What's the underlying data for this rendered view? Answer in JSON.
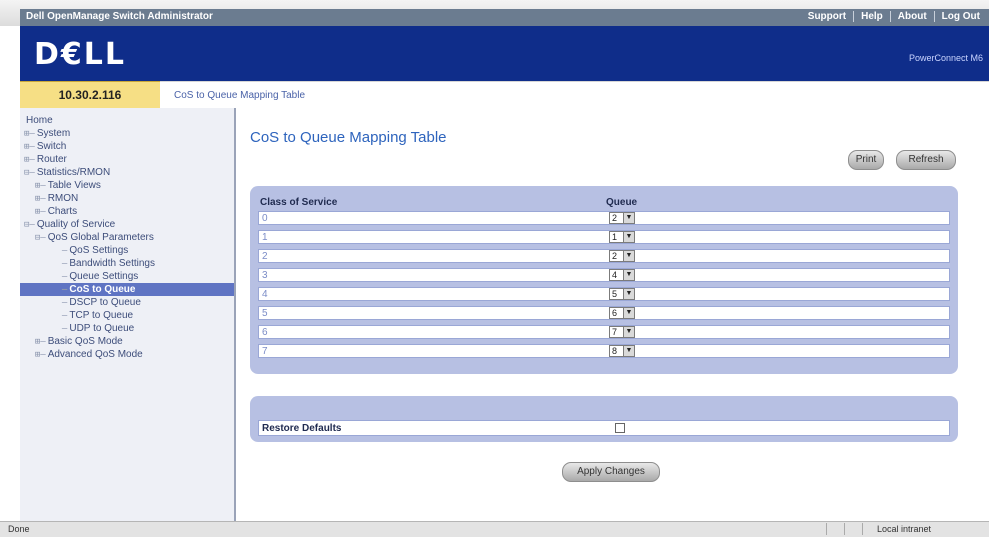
{
  "window": {
    "title": "Dell OpenManage Switch Administrator",
    "links": [
      "Support",
      "Help",
      "About",
      "Log Out"
    ]
  },
  "banner": {
    "logo": "D€LL",
    "subtitle": "PowerConnect M6"
  },
  "device": {
    "ip": "10.30.2.116"
  },
  "breadcrumb": "CoS to Queue Mapping Table",
  "sidebar": {
    "items": [
      {
        "prefix": "",
        "label": "Home"
      },
      {
        "prefix": "⊞—",
        "label": "System"
      },
      {
        "prefix": "⊞—",
        "label": "Switch"
      },
      {
        "prefix": "⊞—",
        "label": "Router"
      },
      {
        "prefix": "⊟—",
        "label": "Statistics/RMON"
      },
      {
        "prefix": "  ⊞—",
        "label": "Table Views"
      },
      {
        "prefix": "  ⊞—",
        "label": "RMON"
      },
      {
        "prefix": "  ⊞—",
        "label": "Charts"
      },
      {
        "prefix": "⊟—",
        "label": "Quality of Service"
      },
      {
        "prefix": "  ⊟—",
        "label": "QoS Global Parameters"
      },
      {
        "prefix": "       —",
        "label": "QoS Settings"
      },
      {
        "prefix": "       —",
        "label": "Bandwidth Settings"
      },
      {
        "prefix": "       —",
        "label": "Queue Settings"
      },
      {
        "prefix": "       —",
        "label": "CoS to Queue"
      },
      {
        "prefix": "       —",
        "label": "DSCP to Queue"
      },
      {
        "prefix": "       —",
        "label": "TCP to Queue"
      },
      {
        "prefix": "       —",
        "label": "UDP to Queue"
      },
      {
        "prefix": "  ⊞—",
        "label": "Basic QoS Mode"
      },
      {
        "prefix": "  ⊞—",
        "label": "Advanced QoS Mode"
      }
    ]
  },
  "main": {
    "title": "CoS to Queue Mapping Table",
    "print_label": "Print",
    "refresh_label": "Refresh",
    "table": {
      "headers": [
        "Class of Service",
        "Queue"
      ],
      "rows": [
        {
          "cos": "0",
          "queue": "2"
        },
        {
          "cos": "1",
          "queue": "1"
        },
        {
          "cos": "2",
          "queue": "2"
        },
        {
          "cos": "3",
          "queue": "4"
        },
        {
          "cos": "4",
          "queue": "5"
        },
        {
          "cos": "5",
          "queue": "6"
        },
        {
          "cos": "6",
          "queue": "7"
        },
        {
          "cos": "7",
          "queue": "8"
        }
      ]
    },
    "restore_label": "Restore Defaults",
    "apply_label": "Apply Changes"
  },
  "status": {
    "left": "Done",
    "zone": "Local intranet"
  }
}
